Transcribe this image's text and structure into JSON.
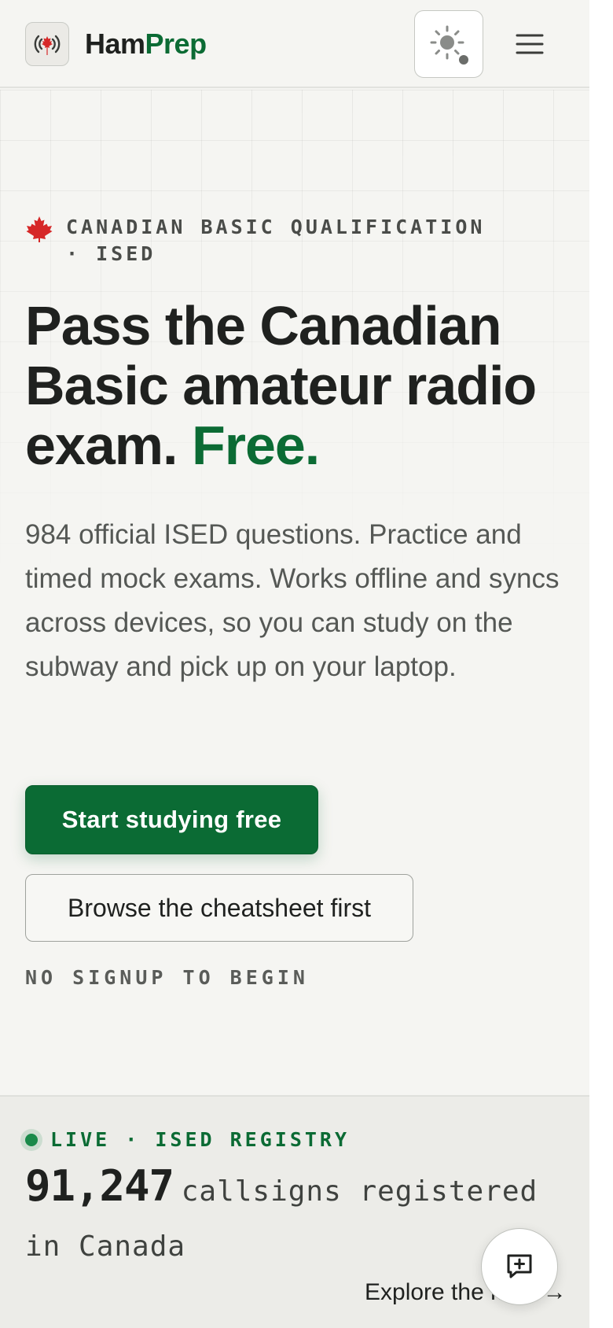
{
  "header": {
    "brand_ham": "Ham",
    "brand_prep": "Prep",
    "logo_icon": "radio-tower-maple-leaf-icon",
    "theme_icon": "sun-icon",
    "menu_icon": "hamburger-menu-icon"
  },
  "hero": {
    "eyebrow": "CANADIAN BASIC QUALIFICATION · ISED",
    "eyebrow_icon": "maple-leaf-icon",
    "headline_main": "Pass the Canadian Basic amateur radio exam.",
    "headline_accent": "Free.",
    "lead": "984 official ISED questions. Practice and timed mock exams. Works offline and syncs across devices, so you can study on the subway and pick up on your laptop.",
    "primary_cta": "Start studying free",
    "secondary_cta": "Browse the cheatsheet first",
    "note": "NO SIGNUP TO BEGIN"
  },
  "stats": {
    "live_label": "LIVE · ISED REGISTRY",
    "count": "91,247",
    "count_suffix": "callsigns registered in Canada",
    "explore_link": "Explore the map →",
    "feedback_icon": "message-plus-icon"
  },
  "colors": {
    "brand_green": "#0b6b34",
    "maple_red": "#d62828",
    "background": "#f5f5f2"
  }
}
